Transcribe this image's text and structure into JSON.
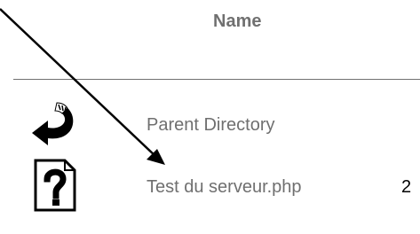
{
  "listing": {
    "columns": {
      "name": "Name"
    },
    "rows": [
      {
        "icon": "back-arrow-icon",
        "name": "Parent Directory",
        "size": ""
      },
      {
        "icon": "unknown-file-icon",
        "name": "Test du serveur.php",
        "size": "2"
      }
    ]
  },
  "annotation": {
    "icon": "pointer-arrow-icon",
    "color": "#000000"
  }
}
